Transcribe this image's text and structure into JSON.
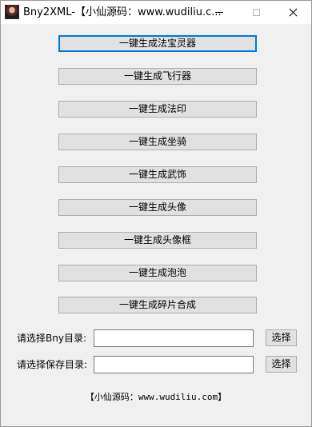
{
  "window": {
    "title": "Bny2XML-【小仙源码：www.wudiliu.c..."
  },
  "buttons": [
    {
      "label": "一键生成法宝灵器"
    },
    {
      "label": "一键生成飞行器"
    },
    {
      "label": "一键生成法印"
    },
    {
      "label": "一键生成坐骑"
    },
    {
      "label": "一键生成武饰"
    },
    {
      "label": "一键生成头像"
    },
    {
      "label": "一键生成头像框"
    },
    {
      "label": "一键生成泡泡"
    },
    {
      "label": "一键生成碎片合成"
    }
  ],
  "bny_dir": {
    "label": "请选择Bny目录:",
    "value": "",
    "button": "选择"
  },
  "save_dir": {
    "label": "请选择保存目录:",
    "value": "",
    "button": "选择"
  },
  "footer": "【小仙源码：www.wudiliu.com】",
  "icons": [
    "app-icon",
    "minimize-icon",
    "maximize-icon",
    "close-icon"
  ]
}
